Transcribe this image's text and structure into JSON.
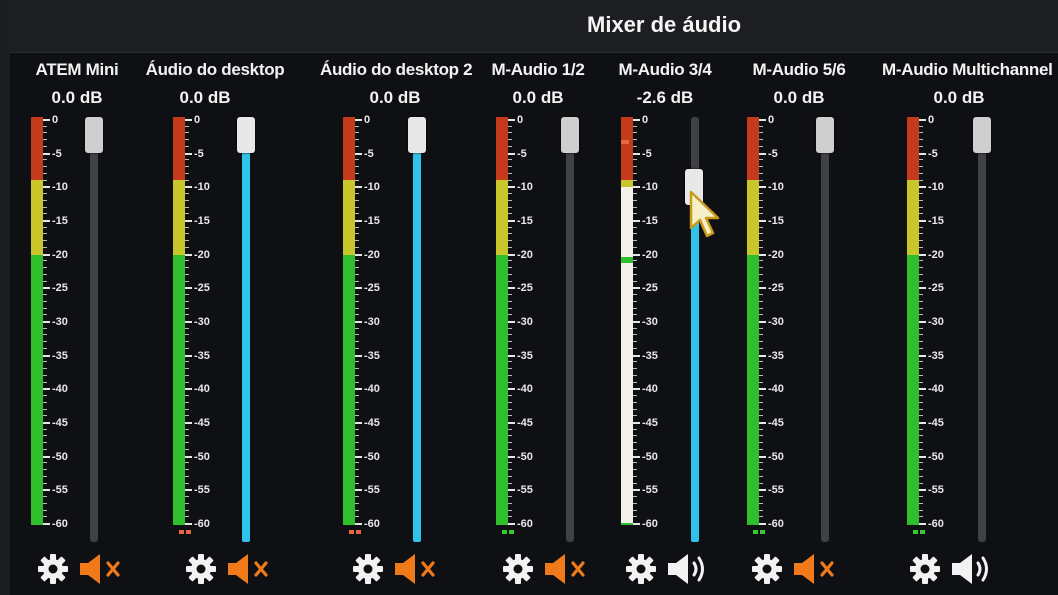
{
  "window": {
    "title": "Mixer de áudio"
  },
  "channels": [
    {
      "name": "ATEM Mini",
      "volume_text": "0.0 dB",
      "muted": true,
      "active": false
    },
    {
      "name": "Áudio do desktop",
      "volume_text": "0.0 dB",
      "muted": true,
      "active": true
    },
    {
      "name": "Áudio do desktop 2",
      "volume_text": "0.0 dB",
      "muted": true,
      "active": true
    },
    {
      "name": "M-Audio 1/2",
      "volume_text": "0.0 dB",
      "muted": true,
      "active": false
    },
    {
      "name": "M-Audio 3/4",
      "volume_text": "-2.6 dB",
      "muted": false,
      "active": true
    },
    {
      "name": "M-Audio 5/6",
      "volume_text": "0.0 dB",
      "muted": true,
      "active": false
    },
    {
      "name": "M-Audio Multichannel",
      "volume_text": "0.0 dB",
      "muted": false,
      "active": false
    }
  ],
  "scale_labels": [
    "0",
    "-5",
    "-10",
    "-15",
    "-20",
    "-25",
    "-30",
    "-35",
    "-40",
    "-45",
    "-50",
    "-55",
    "-60"
  ],
  "colors": {
    "meter_red": "#c43b1c",
    "meter_yellow": "#c9c62b",
    "meter_green": "#2fbf2c",
    "slider_fill": "#2fc3ea",
    "mute_orange": "#f07a1a"
  },
  "icons": {
    "settings": "gear-icon",
    "muted": "speaker-muted-icon",
    "unmuted": "speaker-volume-icon",
    "cursor": "mouse-pointer-icon"
  }
}
